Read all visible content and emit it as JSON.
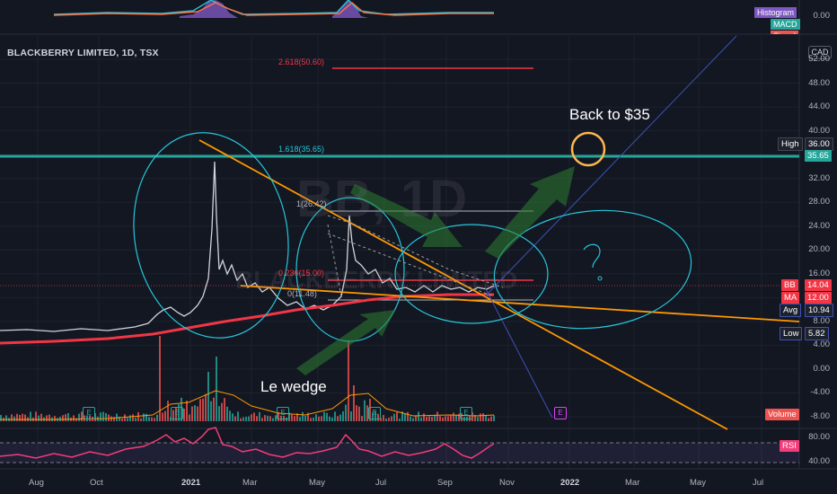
{
  "symbol_title": "BLACKBERRY LIMITED, 1D, TSX",
  "currency": "CAD",
  "watermark_symbol": "BB, 1D",
  "watermark_name": "BLACKBERRY LIMITED",
  "macd_legend": {
    "histogram": "Histogram",
    "macd": "MACD",
    "signal": "Signal"
  },
  "macd_zero": "0.00",
  "price_axis": [
    "52.00",
    "48.00",
    "44.00",
    "40.00",
    "36.00",
    "32.00",
    "28.00",
    "24.00",
    "20.00",
    "16.00",
    "12.00",
    "8.00",
    "4.00",
    "0.00",
    "-4.00",
    "-8.00"
  ],
  "price_axis_values": [
    52,
    48,
    44,
    40,
    36,
    32,
    28,
    24,
    20,
    16,
    12,
    8,
    4,
    0,
    -4,
    -8
  ],
  "tags": {
    "high_label": "High",
    "high_value": "36.00",
    "level_value": "35.65",
    "bb_label": "BB",
    "bb_value": "14.04",
    "ma_label": "MA",
    "ma_value": "12.00",
    "avg_label": "Avg",
    "avg_value": "10.94",
    "low_label": "Low",
    "low_value": "5.82",
    "volume_label": "Volume"
  },
  "rsi": {
    "label": "RSI",
    "axis": [
      "80.00",
      "40.00"
    ]
  },
  "time_axis": [
    "Aug",
    "Oct",
    "2021",
    "Mar",
    "May",
    "Jul",
    "Sep",
    "Nov",
    "2022",
    "Mar",
    "May",
    "Jul"
  ],
  "fib_levels": [
    {
      "label": "2.618(50.60)",
      "value": 50.6,
      "color": "#f23645"
    },
    {
      "label": "1.618(35.65)",
      "value": 35.65,
      "color": "#26c6da"
    },
    {
      "label": "1(26.42)",
      "value": 26.42,
      "color": "#b2b5be"
    },
    {
      "label": "0.236(15.00)",
      "value": 15.0,
      "color": "#f23645"
    },
    {
      "label": "0(11.48)",
      "value": 11.48,
      "color": "#b2b5be"
    }
  ],
  "annotations": {
    "target": "Back to $35",
    "pattern": "Le wedge",
    "question": "?"
  },
  "earnings_marker": "E",
  "earnings_upcoming": "E",
  "colors": {
    "background": "#131722",
    "price_line": "#d1d4dc",
    "ma_line": "#f23645",
    "trendline": "#ff9800",
    "level_line": "#26a69a",
    "circle": "#26c6da",
    "arrow": "#2e7d32",
    "rsi_line": "#f23d7a",
    "volume_up": "#26a69a",
    "volume_down": "#ef5350",
    "macd_hist": "#7e57c2",
    "fan_line": "#3f51b5"
  }
}
